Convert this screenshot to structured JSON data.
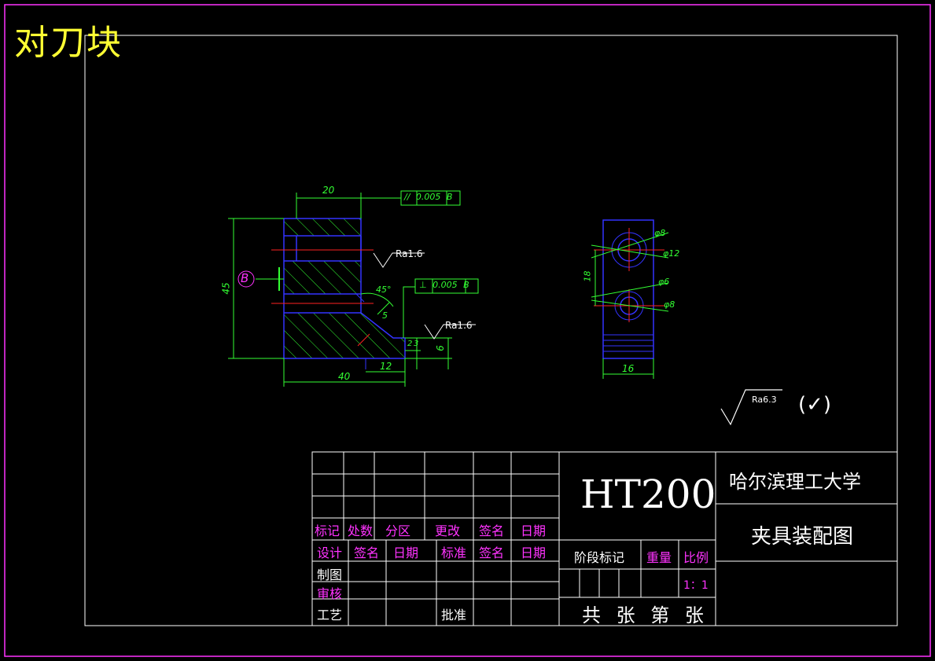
{
  "drawing": {
    "title": "对刀块",
    "material": "HT200",
    "school": "哈尔滨理工大学",
    "drawing_name": "夹具装配图",
    "scale": "1：1",
    "sheet_info": "共 张 第 张",
    "surface_rough_default": "Ra6.3",
    "surface_rough_paren": "(✓)"
  },
  "title_block": {
    "row_labels_1": [
      "标记",
      "处数",
      "分区",
      "更改",
      "签名",
      "日期"
    ],
    "row_labels_2": [
      "设计",
      "签名",
      "日期",
      "标准",
      "签名",
      "日期"
    ],
    "stage_label": "阶段标记",
    "weight_label": "重量",
    "scale_label": "比例",
    "drawn": "制图",
    "checked": "审核",
    "process": "工艺",
    "approved": "批准"
  },
  "annotations": {
    "dim_20": "20",
    "dim_45": "45",
    "dim_40": "40",
    "dim_12": "12",
    "dim_6": "6",
    "dim_2": "2",
    "dim_3": "3",
    "dim_5": "5",
    "angle_45": "45°",
    "datum_b": "B",
    "tol_parallel": "// 0.005 B",
    "tol_perp": "⊥ 0.005 B",
    "ra_1": "Ra1.6",
    "ra_2": "Ra1.6",
    "dim_phi8_top": "φ8",
    "dim_phi12": "φ12",
    "dim_18": "18",
    "dim_phi6": "φ6",
    "dim_phi8_bot": "φ8",
    "dim_16": "16"
  },
  "colors": {
    "border": "#ff33ff",
    "frame": "#ffffff",
    "part": "#3333ff",
    "hatch": "#33ff33",
    "dim": "#33ff33",
    "center": "#ff2222",
    "title": "#ffff33",
    "label": "#ff33ff"
  }
}
